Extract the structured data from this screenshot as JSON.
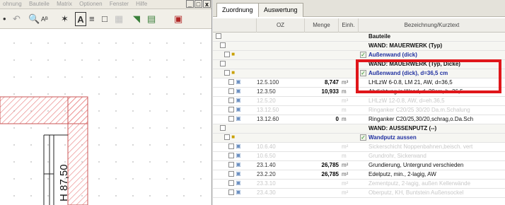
{
  "left_window": {
    "menu": [
      "ohnung",
      "Bauteile",
      "Matrix",
      "Optionen",
      "Fenster",
      "Hilfe"
    ],
    "controls": [
      "_",
      "□",
      "x"
    ],
    "toolbar": [
      "•",
      "↶",
      "🔍",
      "Aᴮ",
      "✶",
      "A",
      "≡",
      "□",
      "▦",
      "◥",
      "▤",
      "▣"
    ],
    "dimension_label": "H 87,50"
  },
  "tabs": [
    "Zuordnung",
    "Auswertung"
  ],
  "columns": [
    "OZ",
    "Menge",
    "Einh.",
    "Bezeichnung/Kurztext"
  ],
  "rows": [
    {
      "oz": "",
      "menge": "",
      "einh": "",
      "desc": "Bauteile",
      "style": "bold"
    },
    {
      "oz": "",
      "menge": "",
      "einh": "",
      "desc": "WAND: MAUERWERK (Typ)",
      "style": "bold"
    },
    {
      "oz": "",
      "menge": "",
      "einh": "",
      "desc": "Außenwand (dick)",
      "style": "blue"
    },
    {
      "oz": "",
      "menge": "",
      "einh": "",
      "desc": "WAND: MAUERWERK (Typ, Dicke)",
      "style": "bold"
    },
    {
      "oz": "",
      "menge": "",
      "einh": "",
      "desc": "Außenwand (dick), d=36,5 cm",
      "style": "blue"
    },
    {
      "oz": "12.5.100",
      "menge": "8,747",
      "einh": "m³",
      "desc": "LHLzW 6-0.8, LM 21, AW, d=36,5",
      "style": "normal"
    },
    {
      "oz": "12.3.50",
      "menge": "10,933",
      "einh": "m",
      "desc": "Abdichtung in Wand, d=30cm, b=36,5",
      "style": "normal"
    },
    {
      "oz": "12.5.20",
      "menge": "",
      "einh": "m³",
      "desc": "LHLzW 12-0.8, AW, d=eh.36,5",
      "style": "faded"
    },
    {
      "oz": "13.12.50",
      "menge": "",
      "einh": "m",
      "desc": "Ringanker C20/25 30/20 Da.m.Schalung",
      "style": "faded"
    },
    {
      "oz": "13.12.60",
      "menge": "0",
      "einh": "m",
      "desc": "Ringanker C20/25,30/20,schrag,o.Da.Sch",
      "style": "normal"
    },
    {
      "oz": "",
      "menge": "",
      "einh": "",
      "desc": "WAND: AUSSENPUTZ (--)",
      "style": "bold"
    },
    {
      "oz": "",
      "menge": "",
      "einh": "",
      "desc": "Wandputz aussen",
      "style": "blue"
    },
    {
      "oz": "10.6.40",
      "menge": "",
      "einh": "m²",
      "desc": "Sickerschicht Noppenbahnen,beisch. vert",
      "style": "faded"
    },
    {
      "oz": "10.6.50",
      "menge": "",
      "einh": "m",
      "desc": "Grundrohr, Sickerwand",
      "style": "faded"
    },
    {
      "oz": "23.1.40",
      "menge": "26,785",
      "einh": "m²",
      "desc": "Grundierung, Untergrund verschieden",
      "style": "normal"
    },
    {
      "oz": "23.2.20",
      "menge": "26,785",
      "einh": "m²",
      "desc": "Edelputz, min., 2-lagig, AW",
      "style": "normal"
    },
    {
      "oz": "23.3.10",
      "menge": "",
      "einh": "m²",
      "desc": "Zementputz, 2-lagig, außen Kellerwände",
      "style": "faded"
    },
    {
      "oz": "23.4.30",
      "menge": "",
      "einh": "m²",
      "desc": "Oberputz, KH, Buntstein Außensockel",
      "style": "faded"
    }
  ],
  "colors": {
    "highlight": "#e0161a",
    "blue_text": "#2030a0",
    "hatch": "#e87a7a"
  }
}
